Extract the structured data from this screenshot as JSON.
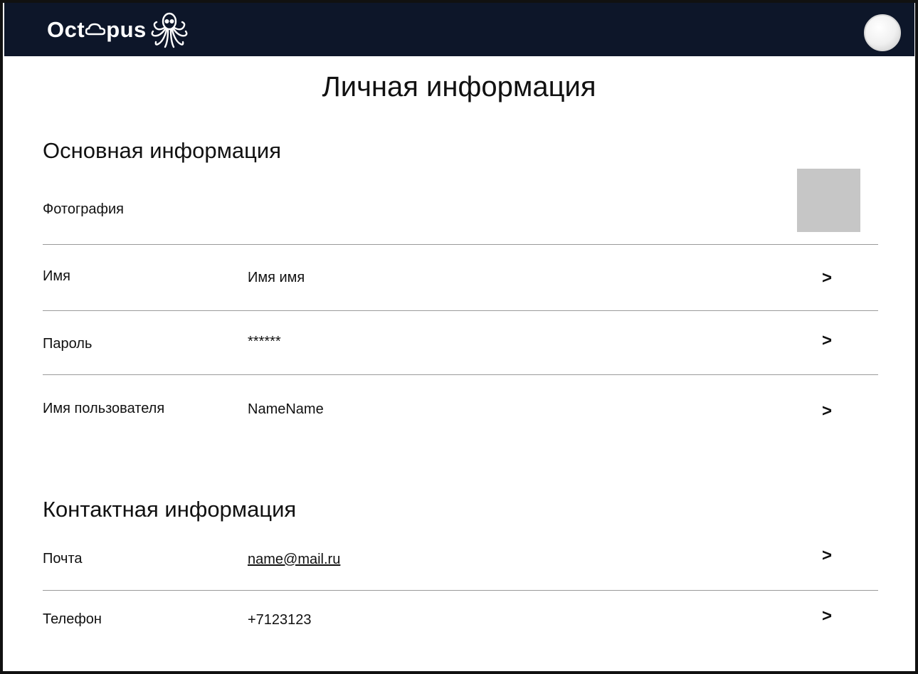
{
  "header": {
    "logo_text_start": "Oct",
    "logo_text_end": "pus",
    "logo_icon": "octopus-logo-icon",
    "avatar_icon": "user-avatar",
    "colors": {
      "bar": "#0d1629",
      "logo": "#ffffff"
    }
  },
  "page_title": "Личная информация",
  "basic": {
    "title": "Основная информация",
    "photo_label": "Фотография",
    "rows": [
      {
        "label": "Имя",
        "value": "Имя имя",
        "action": ">"
      },
      {
        "label": "Пароль",
        "value": "******",
        "action": ">"
      },
      {
        "label": "Имя пользователя",
        "value": "NameName",
        "action": ">"
      }
    ]
  },
  "contact": {
    "title": "Контактная информация",
    "rows": [
      {
        "label": "Почта",
        "value": "name@mail.ru",
        "action": ">"
      },
      {
        "label": "Телефон",
        "value": "+7123123",
        "action": ">"
      }
    ]
  }
}
